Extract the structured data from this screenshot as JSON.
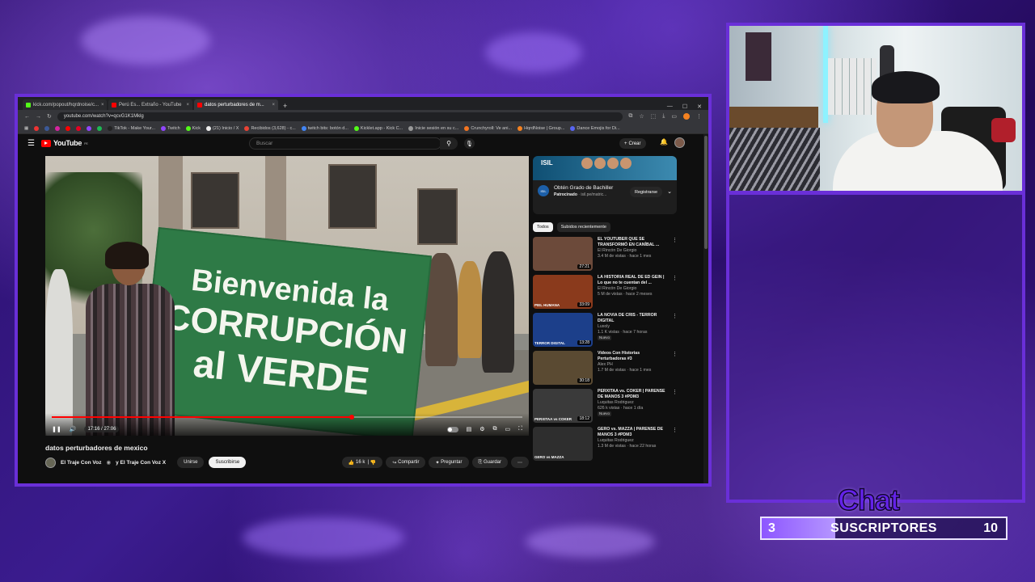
{
  "browser": {
    "tabs": [
      {
        "label": "kick.com/popout/hqrdnoise/c...",
        "color": "#53fc18"
      },
      {
        "label": "Perú Es... Extraño - YouTube",
        "color": "#ff0000"
      },
      {
        "label": "datos perturbadores de m...",
        "color": "#ff0000",
        "active": true
      }
    ],
    "url": "youtube.com/watch?v=qcvG1K1Mklg",
    "bookmarks": [
      "TikTok - Make Your...",
      "Twitch",
      "Kick",
      "(21) Inicio / X",
      "Recibidos (3,628) - c...",
      "twitch bits: botón d...",
      "Kicklet.app - Kick C...",
      "Inicie sesión en su c...",
      "Crunchyroll: Ve ani...",
      "HqrdNoise | Group...",
      "Dance Emojis for Di..."
    ]
  },
  "youtube": {
    "logo_text": "YouTube",
    "logo_region": "PE",
    "search_placeholder": "Buscar",
    "create_label": "Crear",
    "player": {
      "banner_lines": [
        "Bienvenida la",
        "CORRUPCIÓN",
        "al VERDE"
      ],
      "time": "17:16 / 27:06",
      "progress": 0.637
    },
    "video_title": "datos perturbadores de mexico",
    "channel": "El Traje Con Voz",
    "channel_collab": "y El Traje Con Voz X",
    "join_label": "Unirse",
    "subscribe_label": "Suscribirse",
    "likes": "16 k",
    "share_label": "Compartir",
    "ask_label": "Preguntar",
    "save_label": "Guardar",
    "ad": {
      "icon_text": "ISIL",
      "title": "Obtén Grado de Bachiller",
      "sponsored": "Patrocinado",
      "domain": "isil.pe/matric...",
      "button": "Registrarse"
    },
    "chips": [
      "Todos",
      "Subidos recientemente"
    ],
    "recommendations": [
      {
        "title": "EL YOUTUBER QUE SE TRANSFORMÓ EN CANÍBAL ...",
        "channel": "El Rincón De Giorgio",
        "meta": "3.4 M de vistas · hace 1 mes",
        "duration": "27:21",
        "thumb_label": "",
        "color": "#6c4a3a",
        "nuevo": false
      },
      {
        "title": "LA HISTORIA REAL DE ED GEIN | Lo que no te cuentan del ...",
        "channel": "El Rincón De Giorgio",
        "meta": "5 M de vistas · hace 2 meses",
        "duration": "33:09",
        "thumb_label": "PIEL HUMANA",
        "color": "#8a3a1c",
        "nuevo": false
      },
      {
        "title": "LA NOVIA DE CRIS - TERROR DIGITAL",
        "channel": "Luxoly",
        "meta": "1.1 K vistas · hace 7 horas",
        "duration": "13:28",
        "thumb_label": "TERROR DIGITAL",
        "color": "#1c3f8a",
        "nuevo": true
      },
      {
        "title": "Videos Con Historias Perturbadoras #3",
        "channel": "Alex PH",
        "meta": "1.7 M de vistas · hace 1 mes",
        "duration": "30:18",
        "thumb_label": "",
        "color": "#5a4a32",
        "nuevo": false
      },
      {
        "title": "PERXITAA vs. COKER | PARENSE DE MANOS 3 #PDM3",
        "channel": "Luquitas Rodriguez",
        "meta": "626 k vistas · hace 1 día",
        "duration": "18:12",
        "thumb_label": "PERXITAA vs COKER",
        "color": "#3a3a3a",
        "nuevo": true
      },
      {
        "title": "GERO vs. MAZZA | PARENSE DE MANOS 3 #PDM3",
        "channel": "Luquitas Rodriguez",
        "meta": "1.3 M de vistas · hace 22 horas",
        "duration": "",
        "thumb_label": "GERO vs MAZZA",
        "color": "#2e2e2e",
        "nuevo": false
      }
    ]
  },
  "overlay": {
    "chat_title": "Chat",
    "goal_current": "3",
    "goal_label": "SUSCRIPTORES",
    "goal_target": "10",
    "goal_progress": 0.3
  }
}
